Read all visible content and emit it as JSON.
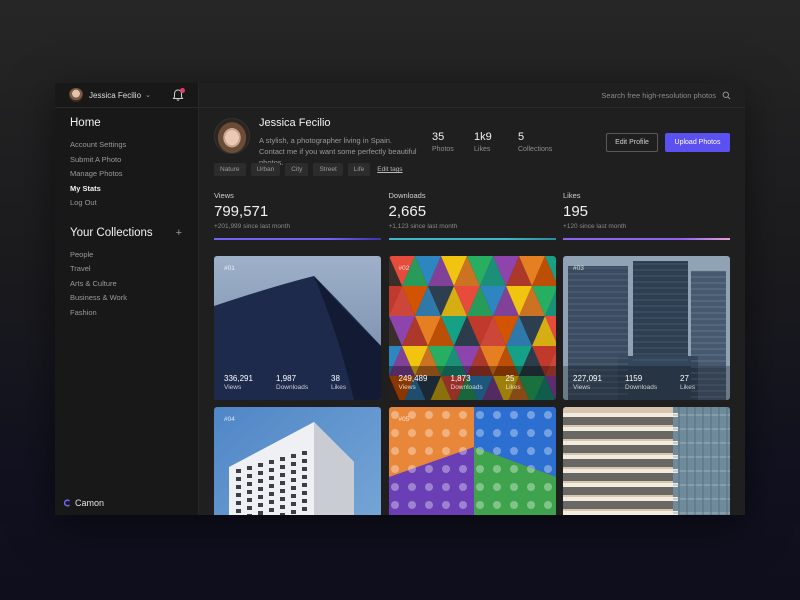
{
  "sidebar": {
    "user_name": "Jessica Fecilio",
    "home_title": "Home",
    "home_items": [
      {
        "label": "Account Settings",
        "active": false
      },
      {
        "label": "Submit A Photo",
        "active": false
      },
      {
        "label": "Manage Photos",
        "active": false
      },
      {
        "label": "My Stats",
        "active": true
      },
      {
        "label": "Log Out",
        "active": false
      }
    ],
    "collections_title": "Your Collections",
    "collections_add": "+",
    "collections": [
      "People",
      "Travel",
      "Arts & Culture",
      "Business & Work",
      "Fashion"
    ],
    "brand": "Camon"
  },
  "topbar": {
    "search_placeholder": "Search free high-resolution photos"
  },
  "profile": {
    "name": "Jessica Fecilio",
    "bio": "A stylish, a photographer living in Spain. Contact me if you want some perfectly beautiful photos.",
    "tags": [
      "Nature",
      "Urban",
      "City",
      "Street",
      "Life"
    ],
    "edit_tags": "Edit tags",
    "stats": [
      {
        "value": "35",
        "label": "Photos"
      },
      {
        "value": "1k9",
        "label": "Likes"
      },
      {
        "value": "5",
        "label": "Collections"
      }
    ],
    "edit_button": "Edit Profile",
    "upload_button": "Upload Photos"
  },
  "metrics": [
    {
      "label": "Views",
      "value": "799,571",
      "sub": "+201,999 since last month",
      "fill": 1.0,
      "color": "#6f63f2",
      "color2": "#3a36a8"
    },
    {
      "label": "Downloads",
      "value": "2,665",
      "sub": "+1,123 since last month",
      "fill": 1.0,
      "color": "#3fb7c6",
      "color2": "#2a8c9b"
    },
    {
      "label": "Likes",
      "value": "195",
      "sub": "+120 since last month",
      "fill": 1.0,
      "color": "#8d63f0",
      "color2": "#e8a0d8"
    }
  ],
  "photos": [
    {
      "num": "#01",
      "views": "336,291",
      "downloads": "1,987",
      "likes": "38",
      "show_stats": true
    },
    {
      "num": "#02",
      "views": "249,489",
      "downloads": "1,873",
      "likes": "25",
      "show_stats": true
    },
    {
      "num": "#03",
      "views": "227,091",
      "downloads": "1159",
      "likes": "27",
      "show_stats": true
    },
    {
      "num": "#04",
      "views": "",
      "downloads": "",
      "likes": "",
      "show_stats": false
    },
    {
      "num": "#05",
      "views": "",
      "downloads": "",
      "likes": "",
      "show_stats": false
    },
    {
      "num": "",
      "views": "",
      "downloads": "",
      "likes": "",
      "show_stats": false
    }
  ],
  "stat_labels": {
    "views": "Views",
    "downloads": "Downloads",
    "likes": "Likes"
  },
  "icons": {
    "notification": "bell-icon",
    "search": "search-icon",
    "chevron": "chevron-down-icon",
    "brand": "camon-logo-icon"
  },
  "colors": {
    "accent": "#5b51f0",
    "notification_dot": "#e0406a"
  }
}
